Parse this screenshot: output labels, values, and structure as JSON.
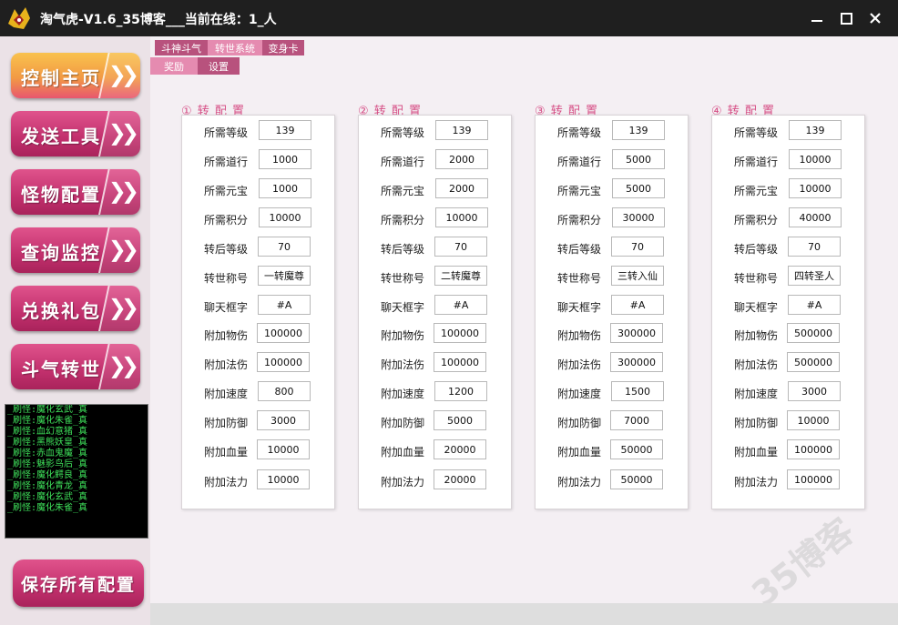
{
  "window": {
    "title": "淘气虎-V1.6_35博客___当前在线：1_人"
  },
  "sidebar": {
    "nav": [
      {
        "label": "控制主页",
        "active": true
      },
      {
        "label": "发送工具",
        "active": false
      },
      {
        "label": "怪物配置",
        "active": false
      },
      {
        "label": "查询监控",
        "active": false
      },
      {
        "label": "兑换礼包",
        "active": false
      },
      {
        "label": "斗气转世",
        "active": false
      }
    ],
    "log_lines": [
      "_刷怪:魔化玄武_真",
      "_刷怪:魔化朱雀_真",
      "_刷怪:血幻意猪_真",
      "_刷怪:黑熊妖皇_真",
      "_刷怪:赤血鬼魔_真",
      "_刷怪:魅影鸟后_真",
      "_刷怪:魔化鳄良_真",
      "_刷怪:魔化青龙_真",
      "_刷怪:魔化玄武_真",
      "_刷怪:魔化朱雀_真"
    ],
    "save_label": "保存所有配置"
  },
  "tabs": {
    "top": [
      "斗神斗气",
      "转世系统",
      "变身卡"
    ],
    "sub": [
      "奖励",
      "设置"
    ]
  },
  "field_labels": [
    "所需等级",
    "所需道行",
    "所需元宝",
    "所需积分",
    "转后等级",
    "转世称号",
    "聊天框字",
    "附加物伤",
    "附加法伤",
    "附加速度",
    "附加防御",
    "附加血量",
    "附加法力"
  ],
  "panels": [
    {
      "title": "① 转 配 置",
      "values": [
        "139",
        "1000",
        "1000",
        "10000",
        "70",
        "一转魔尊",
        "#A",
        "100000",
        "100000",
        "800",
        "3000",
        "10000",
        "10000"
      ]
    },
    {
      "title": "② 转 配 置",
      "values": [
        "139",
        "2000",
        "2000",
        "10000",
        "70",
        "二转魔尊",
        "#A",
        "100000",
        "100000",
        "1200",
        "5000",
        "20000",
        "20000"
      ]
    },
    {
      "title": "③ 转 配 置",
      "values": [
        "139",
        "5000",
        "5000",
        "30000",
        "70",
        "三转入仙",
        "#A",
        "300000",
        "300000",
        "1500",
        "7000",
        "50000",
        "50000"
      ]
    },
    {
      "title": "④ 转 配 置",
      "values": [
        "139",
        "10000",
        "10000",
        "40000",
        "70",
        "四转圣人",
        "#A",
        "500000",
        "500000",
        "3000",
        "10000",
        "100000",
        "100000"
      ]
    }
  ],
  "watermark": "35博客",
  "colors": {
    "accent": "#c2306d",
    "active_nav": "#f29a44",
    "log_text": "#3ee05a",
    "panel_title": "#d64f86"
  }
}
